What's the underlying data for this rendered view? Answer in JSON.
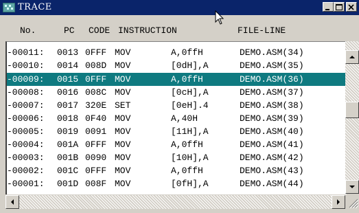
{
  "window": {
    "title": "TRACE",
    "titlebar_color": "#0a246a",
    "selection_color": "#0f7a80",
    "buttons": [
      "minimize-icon",
      "maximize-icon",
      "close-icon"
    ]
  },
  "header": {
    "no": "No.",
    "pc": "PC",
    "code": "CODE",
    "instruction": "INSTRUCTION",
    "file_line": "FILE-LINE"
  },
  "rows": [
    {
      "no": "-00011:",
      "pc": "0013",
      "code": "0FFF",
      "mnemonic": "MOV",
      "operand": "A,0ffH",
      "file_line": "DEMO.ASM(34)"
    },
    {
      "no": "-00010:",
      "pc": "0014",
      "code": "008D",
      "mnemonic": "MOV",
      "operand": "[0dH],A",
      "file_line": "DEMO.ASM(35)"
    },
    {
      "no": "-00009:",
      "pc": "0015",
      "code": "0FFF",
      "mnemonic": "MOV",
      "operand": "A,0ffH",
      "file_line": "DEMO.ASM(36)",
      "selected": true
    },
    {
      "no": "-00008:",
      "pc": "0016",
      "code": "008C",
      "mnemonic": "MOV",
      "operand": "[0cH],A",
      "file_line": "DEMO.ASM(37)"
    },
    {
      "no": "-00007:",
      "pc": "0017",
      "code": "320E",
      "mnemonic": "SET",
      "operand": "[0eH].4",
      "file_line": "DEMO.ASM(38)"
    },
    {
      "no": "-00006:",
      "pc": "0018",
      "code": "0F40",
      "mnemonic": "MOV",
      "operand": "A,40H",
      "file_line": "DEMO.ASM(39)"
    },
    {
      "no": "-00005:",
      "pc": "0019",
      "code": "0091",
      "mnemonic": "MOV",
      "operand": "[11H],A",
      "file_line": "DEMO.ASM(40)"
    },
    {
      "no": "-00004:",
      "pc": "001A",
      "code": "0FFF",
      "mnemonic": "MOV",
      "operand": "A,0ffH",
      "file_line": "DEMO.ASM(41)"
    },
    {
      "no": "-00003:",
      "pc": "001B",
      "code": "0090",
      "mnemonic": "MOV",
      "operand": "[10H],A",
      "file_line": "DEMO.ASM(42)"
    },
    {
      "no": "-00002:",
      "pc": "001C",
      "code": "0FFF",
      "mnemonic": "MOV",
      "operand": "A,0ffH",
      "file_line": "DEMO.ASM(43)"
    },
    {
      "no": "-00001:",
      "pc": "001D",
      "code": "008F",
      "mnemonic": "MOV",
      "operand": "[0fH],A",
      "file_line": "DEMO.ASM(44)"
    }
  ],
  "icons": {
    "app": "trace-window-icon",
    "cursor": "mouse-cursor-icon",
    "scroll_up": "scroll-up-arrow-icon",
    "scroll_down": "scroll-down-arrow-icon",
    "scroll_left": "scroll-left-arrow-icon",
    "scroll_right": "scroll-right-arrow-icon",
    "grip": "resize-grip-icon"
  }
}
